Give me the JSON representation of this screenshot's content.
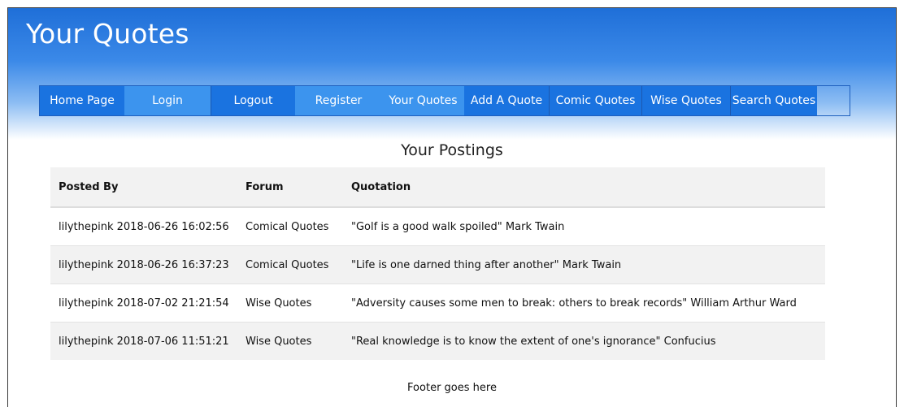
{
  "header": {
    "site_title": "Your Quotes"
  },
  "nav": {
    "items": [
      {
        "label": "Home Page"
      },
      {
        "label": "Login"
      },
      {
        "label": "Logout"
      },
      {
        "label": "Register"
      },
      {
        "label": "Your Quotes"
      },
      {
        "label": "Add A Quote"
      },
      {
        "label": "Comic Quotes"
      },
      {
        "label": "Wise Quotes"
      },
      {
        "label": "Search Quotes"
      }
    ]
  },
  "main": {
    "title": "Your Postings",
    "table": {
      "headers": [
        "Posted By",
        "Forum",
        "Quotation"
      ],
      "rows": [
        {
          "posted_by": "lilythepink 2018-06-26 16:02:56",
          "forum": "Comical Quotes",
          "quotation": "\"Golf is a good walk spoiled\" Mark Twain"
        },
        {
          "posted_by": "lilythepink 2018-06-26 16:37:23",
          "forum": "Comical Quotes",
          "quotation": "\"Life is one darned thing after another\" Mark Twain"
        },
        {
          "posted_by": "lilythepink 2018-07-02 21:21:54",
          "forum": "Wise Quotes",
          "quotation": "\"Adversity causes some men to break: others to break records\" William Arthur Ward"
        },
        {
          "posted_by": "lilythepink 2018-07-06 11:51:21",
          "forum": "Wise Quotes",
          "quotation": "\"Real knowledge is to know the extent of one's ignorance\" Confucius"
        }
      ]
    }
  },
  "footer": {
    "text": "Footer goes here"
  },
  "colors": {
    "nav_dark": "#1a73e0",
    "nav_light": "#3c94ee",
    "header_top": "#1f6fd8"
  }
}
